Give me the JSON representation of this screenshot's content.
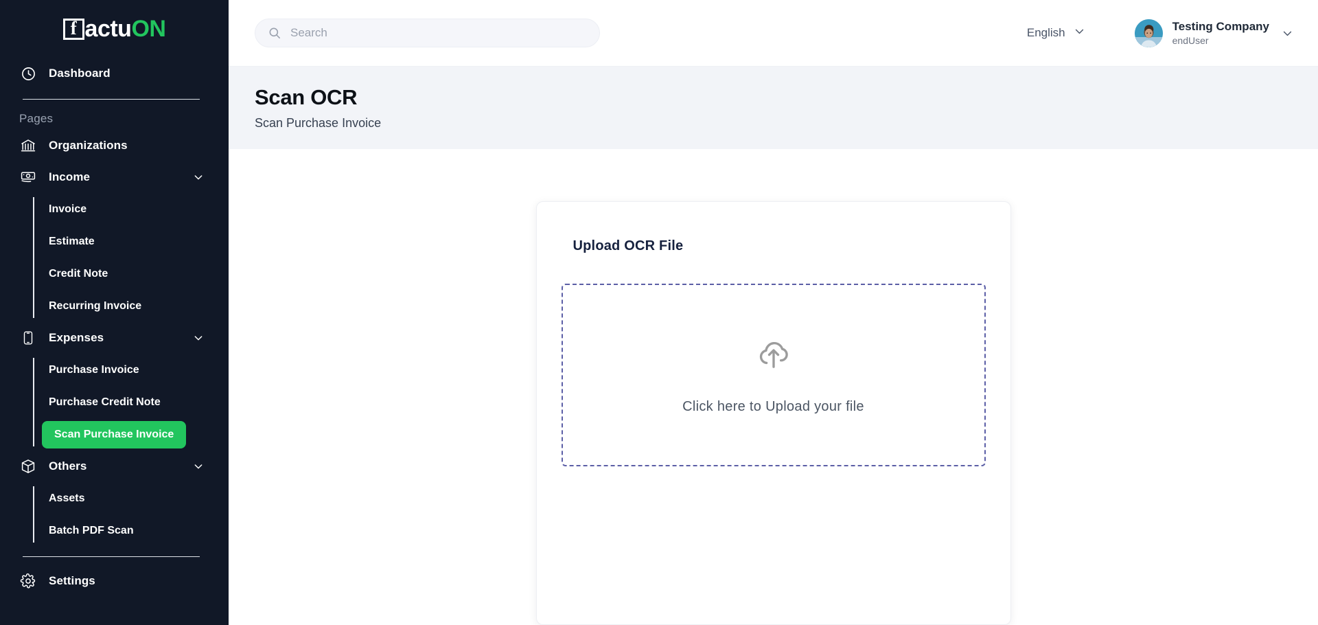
{
  "brand": {
    "logo_mark": "f-square-icon",
    "name_part_1": "actu",
    "name_part_2": "ON",
    "accent_color": "#22c55e",
    "sidebar_color": "#111827"
  },
  "sidebar": {
    "dashboard": {
      "label": "Dashboard",
      "icon": "clock-icon"
    },
    "section_label": "Pages",
    "items": [
      {
        "label": "Organizations",
        "icon": "bank-icon",
        "expandable": false
      },
      {
        "label": "Income",
        "icon": "banknote-icon",
        "expandable": true,
        "chevron": "chevron-down-icon"
      },
      {
        "label": "Expenses",
        "icon": "mobile-icon",
        "expandable": true,
        "chevron": "chevron-down-icon"
      },
      {
        "label": "Others",
        "icon": "box-icon",
        "expandable": true,
        "chevron": "chevron-down-icon"
      }
    ],
    "income_children": [
      {
        "label": "Invoice",
        "active": false
      },
      {
        "label": "Estimate",
        "active": false
      },
      {
        "label": "Credit Note",
        "active": false
      },
      {
        "label": "Recurring Invoice",
        "active": false
      }
    ],
    "expenses_children": [
      {
        "label": "Purchase Invoice",
        "active": false
      },
      {
        "label": "Purchase Credit Note",
        "active": false
      },
      {
        "label": "Scan Purchase Invoice",
        "active": true
      }
    ],
    "others_children": [
      {
        "label": "Assets",
        "active": false
      },
      {
        "label": "Batch PDF Scan",
        "active": false
      }
    ],
    "settings": {
      "label": "Settings",
      "icon": "gear-icon"
    }
  },
  "topbar": {
    "search": {
      "placeholder": "Search",
      "value": "",
      "icon": "search-icon"
    },
    "language": {
      "label": "English",
      "chevron": "chevron-down-icon"
    },
    "user": {
      "name": "Testing Company",
      "role": "endUser",
      "avatar": "user-avatar",
      "chevron": "chevron-down-icon"
    }
  },
  "page": {
    "title": "Scan OCR",
    "subtitle": "Scan Purchase Invoice"
  },
  "upload_card": {
    "title": "Upload OCR File",
    "dropzone": {
      "icon": "cloud-upload-icon",
      "text": "Click here to Upload your file",
      "border_color": "#5b5ea6"
    }
  }
}
